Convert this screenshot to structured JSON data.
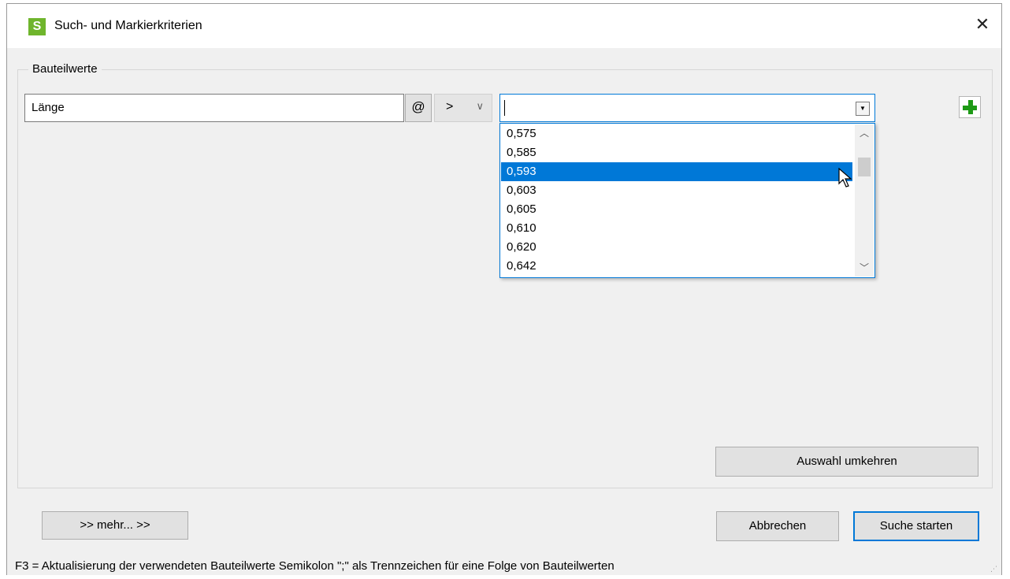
{
  "window": {
    "title": "Such- und Markierkriterien",
    "app_icon_letter": "S"
  },
  "group": {
    "title": "Bauteilwerte"
  },
  "criteria": {
    "name_value": "Länge",
    "at_label": "@",
    "operator": ">",
    "value": ""
  },
  "dropdown": {
    "items": [
      "0,575",
      "0,585",
      "0,593",
      "0,603",
      "0,605",
      "0,610",
      "0,620",
      "0,642"
    ],
    "selected_index": 2
  },
  "buttons": {
    "invert": "Auswahl umkehren",
    "more": ">> mehr... >>",
    "cancel": "Abbrechen",
    "search": "Suche starten"
  },
  "status": {
    "text": "F3 = Aktualisierung der verwendeten Bauteilwerte    Semikolon \";\" als Trennzeichen für eine Folge von Bauteilwerten"
  },
  "colors": {
    "accent": "#0078d7",
    "add_icon": "#1e9a16",
    "app_icon": "#6fb52c"
  }
}
